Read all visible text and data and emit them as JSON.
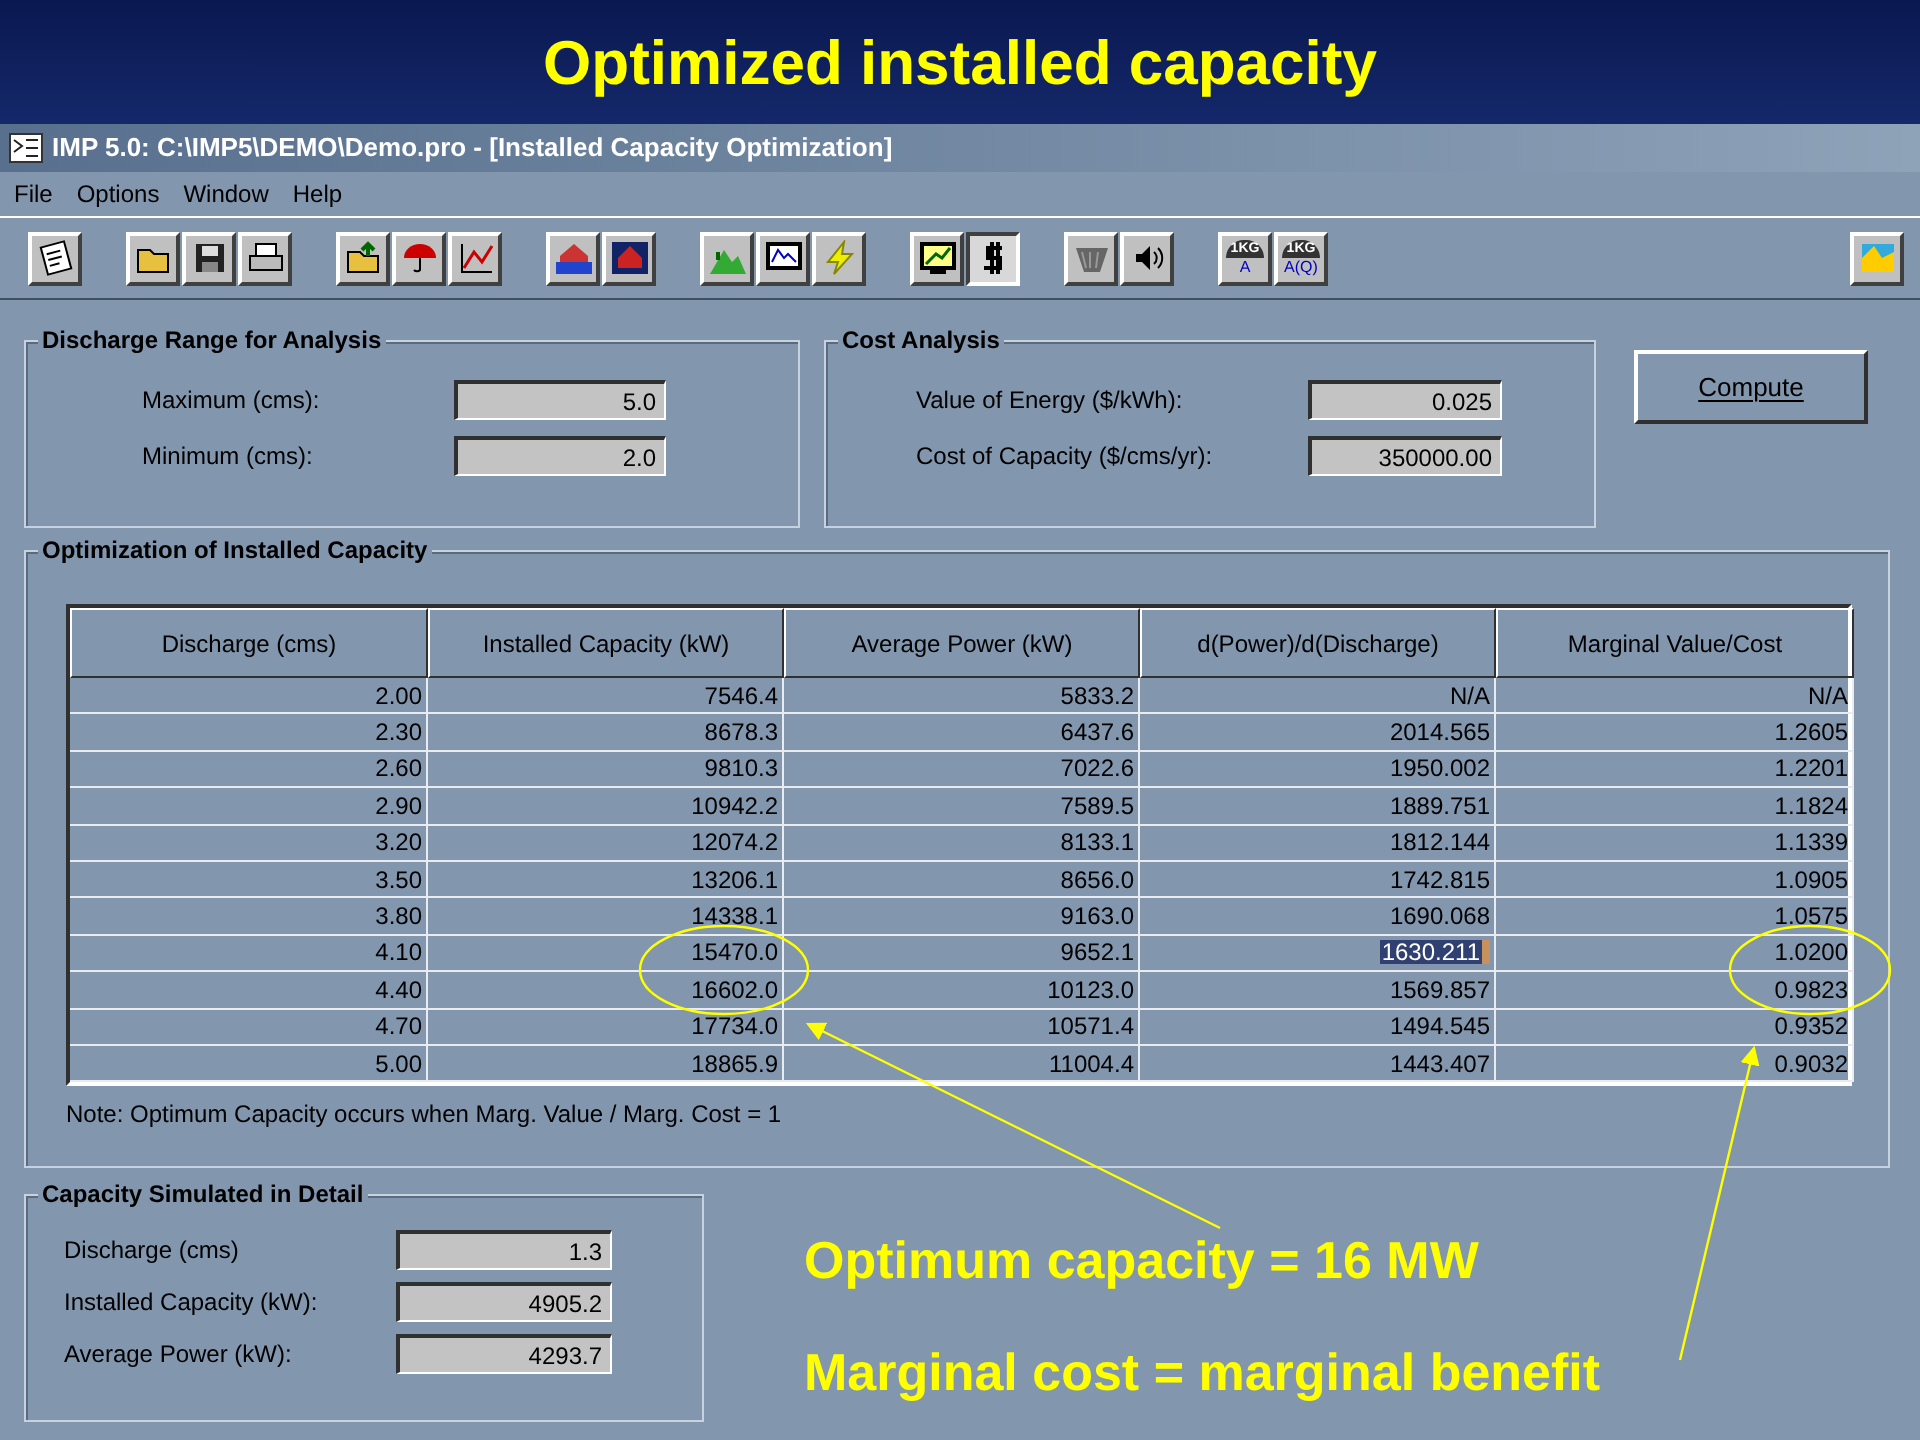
{
  "slide": {
    "title": "Optimized installed capacity"
  },
  "window": {
    "title": "IMP 5.0: C:\\IMP5\\DEMO\\Demo.pro - [Installed Capacity Optimization]"
  },
  "menu": [
    "File",
    "Options",
    "Window",
    "Help"
  ],
  "toolbar": [
    [
      {
        "kind": "notepad",
        "pressed": false
      }
    ],
    [
      {
        "kind": "open",
        "pressed": false
      },
      {
        "kind": "save",
        "pressed": false
      },
      {
        "kind": "print",
        "pressed": false
      }
    ],
    [
      {
        "kind": "folder-up",
        "pressed": false
      },
      {
        "kind": "umbrella",
        "pressed": false
      },
      {
        "kind": "chart",
        "pressed": false
      }
    ],
    [
      {
        "kind": "house-water",
        "pressed": false
      },
      {
        "kind": "house-red",
        "pressed": false
      }
    ],
    [
      {
        "kind": "hill",
        "pressed": false
      },
      {
        "kind": "monitor",
        "pressed": false
      },
      {
        "kind": "lightning",
        "pressed": false
      }
    ],
    [
      {
        "kind": "monitor-chart",
        "pressed": false
      },
      {
        "kind": "dollar",
        "pressed": true
      }
    ],
    [
      {
        "kind": "valve",
        "pressed": false
      },
      {
        "kind": "speaker",
        "pressed": false
      }
    ],
    [
      {
        "kind": "weight",
        "pressed": false,
        "weight": "1KG",
        "label": "A"
      },
      {
        "kind": "weight",
        "pressed": false,
        "weight": "1KG",
        "label": "A(Q)"
      }
    ]
  ],
  "discharge_range": {
    "title": "Discharge Range for Analysis",
    "fields": [
      {
        "label": "Maximum (cms):",
        "value": "5.0"
      },
      {
        "label": "Minimum (cms):",
        "value": "2.0"
      }
    ]
  },
  "cost_analysis": {
    "title": "Cost Analysis",
    "fields": [
      {
        "label": "Value of Energy ($/kWh):",
        "value": "0.025"
      },
      {
        "label": "Cost of Capacity ($/cms/yr):",
        "value": "350000.00"
      }
    ]
  },
  "compute_button": "Compute",
  "optimization": {
    "title": "Optimization of Installed Capacity",
    "table": {
      "columns": [
        "Discharge (cms)",
        "Installed Capacity (kW)",
        "Average Power (kW)",
        "d(Power)/d(Discharge)",
        "Marginal Value/Cost"
      ],
      "rows": [
        {
          "cells": [
            "2.00",
            "7546.4",
            "5833.2",
            "N/A",
            "N/A"
          ],
          "selected": false
        },
        {
          "cells": [
            "2.30",
            "8678.3",
            "6437.6",
            "2014.565",
            "1.2605"
          ],
          "selected": false
        },
        {
          "cells": [
            "2.60",
            "9810.3",
            "7022.6",
            "1950.002",
            "1.2201"
          ],
          "selected": false
        },
        {
          "cells": [
            "2.90",
            "10942.2",
            "7589.5",
            "1889.751",
            "1.1824"
          ],
          "selected": false
        },
        {
          "cells": [
            "3.20",
            "12074.2",
            "8133.1",
            "1812.144",
            "1.1339"
          ],
          "selected": false
        },
        {
          "cells": [
            "3.50",
            "13206.1",
            "8656.0",
            "1742.815",
            "1.0905"
          ],
          "selected": false
        },
        {
          "cells": [
            "3.80",
            "14338.1",
            "9163.0",
            "1690.068",
            "1.0575"
          ],
          "selected": false
        },
        {
          "cells": [
            "4.10",
            "15470.0",
            "9652.1",
            "1630.211",
            "1.0200"
          ],
          "selected": true
        },
        {
          "cells": [
            "4.40",
            "16602.0",
            "10123.0",
            "1569.857",
            "0.9823"
          ],
          "selected": false
        },
        {
          "cells": [
            "4.70",
            "17734.0",
            "10571.4",
            "1494.545",
            "0.9352"
          ],
          "selected": false
        },
        {
          "cells": [
            "5.00",
            "18865.9",
            "11004.4",
            "1443.407",
            "0.9032"
          ],
          "selected": false
        }
      ]
    },
    "note": "Note: Optimum Capacity occurs when Marg. Value / Marg. Cost = 1"
  },
  "simulated": {
    "title": "Capacity Simulated in Detail",
    "fields": [
      {
        "label": "Discharge (cms)",
        "value": "1.3"
      },
      {
        "label": "Installed Capacity (kW):",
        "value": "4905.2"
      },
      {
        "label": "Average Power (kW):",
        "value": "4293.7"
      }
    ]
  },
  "annotations": [
    "Optimum capacity = 16 MW",
    "Marginal cost = marginal benefit"
  ]
}
